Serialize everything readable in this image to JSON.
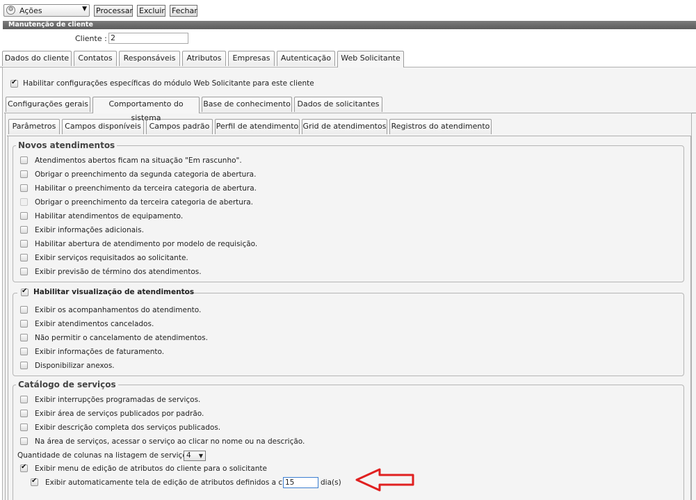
{
  "toolbar": {
    "actions_label": "Ações",
    "actions_icon": "gear-icon",
    "processar": "Processar",
    "excluir": "Excluir",
    "fechar": "Fechar"
  },
  "header": {
    "title": "Manutenção de cliente"
  },
  "cliente": {
    "label": "Cliente :",
    "value": "2"
  },
  "main_tabs": [
    "Dados do cliente",
    "Contatos",
    "Responsáveis",
    "Atributos",
    "Empresas",
    "Autenticação",
    "Web Solicitante"
  ],
  "web": {
    "enable_label": "Habilitar configurações específicas do módulo Web Solicitante para este cliente",
    "enable_checked": true
  },
  "sub_tabs": [
    "Configurações gerais",
    "Comportamento do sistema",
    "Base de conhecimento",
    "Dados de solicitantes"
  ],
  "inner_tabs": [
    "Parâmetros",
    "Campos disponíveis",
    "Campos padrão",
    "Perfil de atendimento",
    "Grid de atendimentos",
    "Registros do atendimento"
  ],
  "novos": {
    "title": "Novos atendimentos",
    "items": [
      {
        "label": "Atendimentos abertos ficam na situação \"Em rascunho\".",
        "checked": false
      },
      {
        "label": "Obrigar o preenchimento da segunda categoria de abertura.",
        "checked": false
      },
      {
        "label": "Habilitar o preenchimento da terceira categoria de abertura.",
        "checked": false
      },
      {
        "label": "Obrigar o preenchimento da terceira categoria de abertura.",
        "checked": false,
        "disabled": true
      },
      {
        "label": "Habilitar atendimentos de equipamento.",
        "checked": false
      },
      {
        "label": "Exibir informações adicionais.",
        "checked": false
      },
      {
        "label": "Habilitar abertura de atendimento por modelo de requisição.",
        "checked": false
      },
      {
        "label": "Exibir serviços requisitados ao solicitante.",
        "checked": false
      },
      {
        "label": "Exibir previsão de término dos atendimentos.",
        "checked": false
      }
    ]
  },
  "visualizacao": {
    "title": "Habilitar visualização de atendimentos",
    "checked": true,
    "items": [
      {
        "label": "Exibir os acompanhamentos do atendimento.",
        "checked": false
      },
      {
        "label": "Exibir atendimentos cancelados.",
        "checked": false
      },
      {
        "label": "Não permitir o cancelamento de atendimentos.",
        "checked": false
      },
      {
        "label": "Exibir informações de faturamento.",
        "checked": false
      },
      {
        "label": "Disponibilizar anexos.",
        "checked": false
      }
    ]
  },
  "catalogo": {
    "title": "Catálogo de serviços",
    "items": [
      {
        "label": "Exibir interrupções programadas de serviços.",
        "checked": false
      },
      {
        "label": "Exibir área de serviços publicados por padrão.",
        "checked": false
      },
      {
        "label": "Exibir descrição completa dos serviços publicados.",
        "checked": false
      },
      {
        "label": "Na área de serviços, acessar o serviço ao clicar no nome ou na descrição.",
        "checked": false
      }
    ],
    "colunas_label": "Quantidade de colunas na listagem de serviços",
    "colunas_value": "4",
    "menu_label": "Exibir menu de edição de atributos do cliente para o solicitante",
    "menu_checked": true,
    "auto_label": "Exibir automaticamente tela de edição de atributos definidos a cada",
    "auto_checked": true,
    "auto_value": "15",
    "auto_unit": "dia(s)"
  },
  "annotation": {
    "color": "#e02020"
  }
}
